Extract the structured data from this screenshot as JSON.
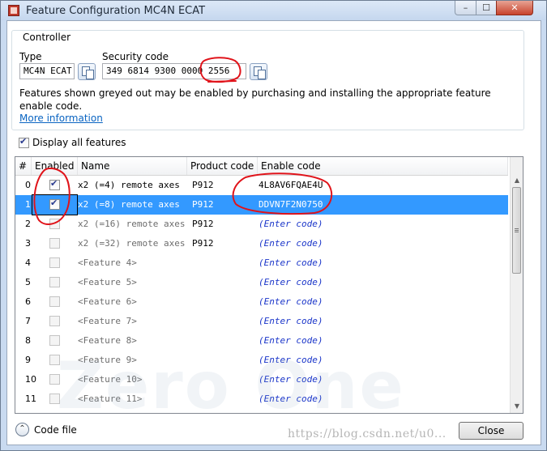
{
  "window": {
    "title": "Feature Configuration MC4N ECAT",
    "controls": {
      "minimize": "–",
      "maximize": "☐",
      "close": "✕"
    }
  },
  "controller": {
    "group_label": "Controller",
    "type_label": "Type",
    "type_value": "MC4N ECAT",
    "security_label": "Security code",
    "security_value": "349 6814 9300 0000 2556",
    "info_text": "Features shown greyed out may be enabled by purchasing and installing the appropriate feature enable code.",
    "more_info_link": "More information"
  },
  "display_all": {
    "label": "Display all features",
    "checked": true
  },
  "grid": {
    "columns": [
      "#",
      "Enabled",
      "Name",
      "Product code",
      "Enable code"
    ],
    "rows": [
      {
        "num": "0",
        "enabled": true,
        "name": "x2 (=4) remote axes",
        "product": "P912",
        "code": "4L8AV6FQAE4U",
        "state": "active"
      },
      {
        "num": "1",
        "enabled": true,
        "name": "x2 (=8) remote axes",
        "product": "P912",
        "code": "DDVN7F2N0750",
        "state": "selected"
      },
      {
        "num": "2",
        "enabled": false,
        "name": "x2 (=16) remote axes",
        "product": "P912",
        "code": "(Enter code)",
        "state": "grey"
      },
      {
        "num": "3",
        "enabled": false,
        "name": "x2 (=32) remote axes",
        "product": "P912",
        "code": "(Enter code)",
        "state": "grey"
      },
      {
        "num": "4",
        "enabled": false,
        "name": "<Feature 4>",
        "product": "",
        "code": "(Enter code)",
        "state": "grey"
      },
      {
        "num": "5",
        "enabled": false,
        "name": "<Feature 5>",
        "product": "",
        "code": "(Enter code)",
        "state": "grey"
      },
      {
        "num": "6",
        "enabled": false,
        "name": "<Feature 6>",
        "product": "",
        "code": "(Enter code)",
        "state": "grey"
      },
      {
        "num": "7",
        "enabled": false,
        "name": "<Feature 7>",
        "product": "",
        "code": "(Enter code)",
        "state": "grey"
      },
      {
        "num": "8",
        "enabled": false,
        "name": "<Feature 8>",
        "product": "",
        "code": "(Enter code)",
        "state": "grey"
      },
      {
        "num": "9",
        "enabled": false,
        "name": "<Feature 9>",
        "product": "",
        "code": "(Enter code)",
        "state": "grey"
      },
      {
        "num": "10",
        "enabled": false,
        "name": "<Feature 10>",
        "product": "",
        "code": "(Enter code)",
        "state": "grey"
      },
      {
        "num": "11",
        "enabled": false,
        "name": "<Feature 11>",
        "product": "",
        "code": "(Enter code)",
        "state": "grey"
      }
    ]
  },
  "footer": {
    "code_file_label": "Code file",
    "close_label": "Close"
  },
  "watermark": {
    "brand": "Zero One",
    "url": "https://blog.csdn.net/u0..."
  },
  "annotation_color": "#e0131a",
  "selection_color": "#3399ff"
}
